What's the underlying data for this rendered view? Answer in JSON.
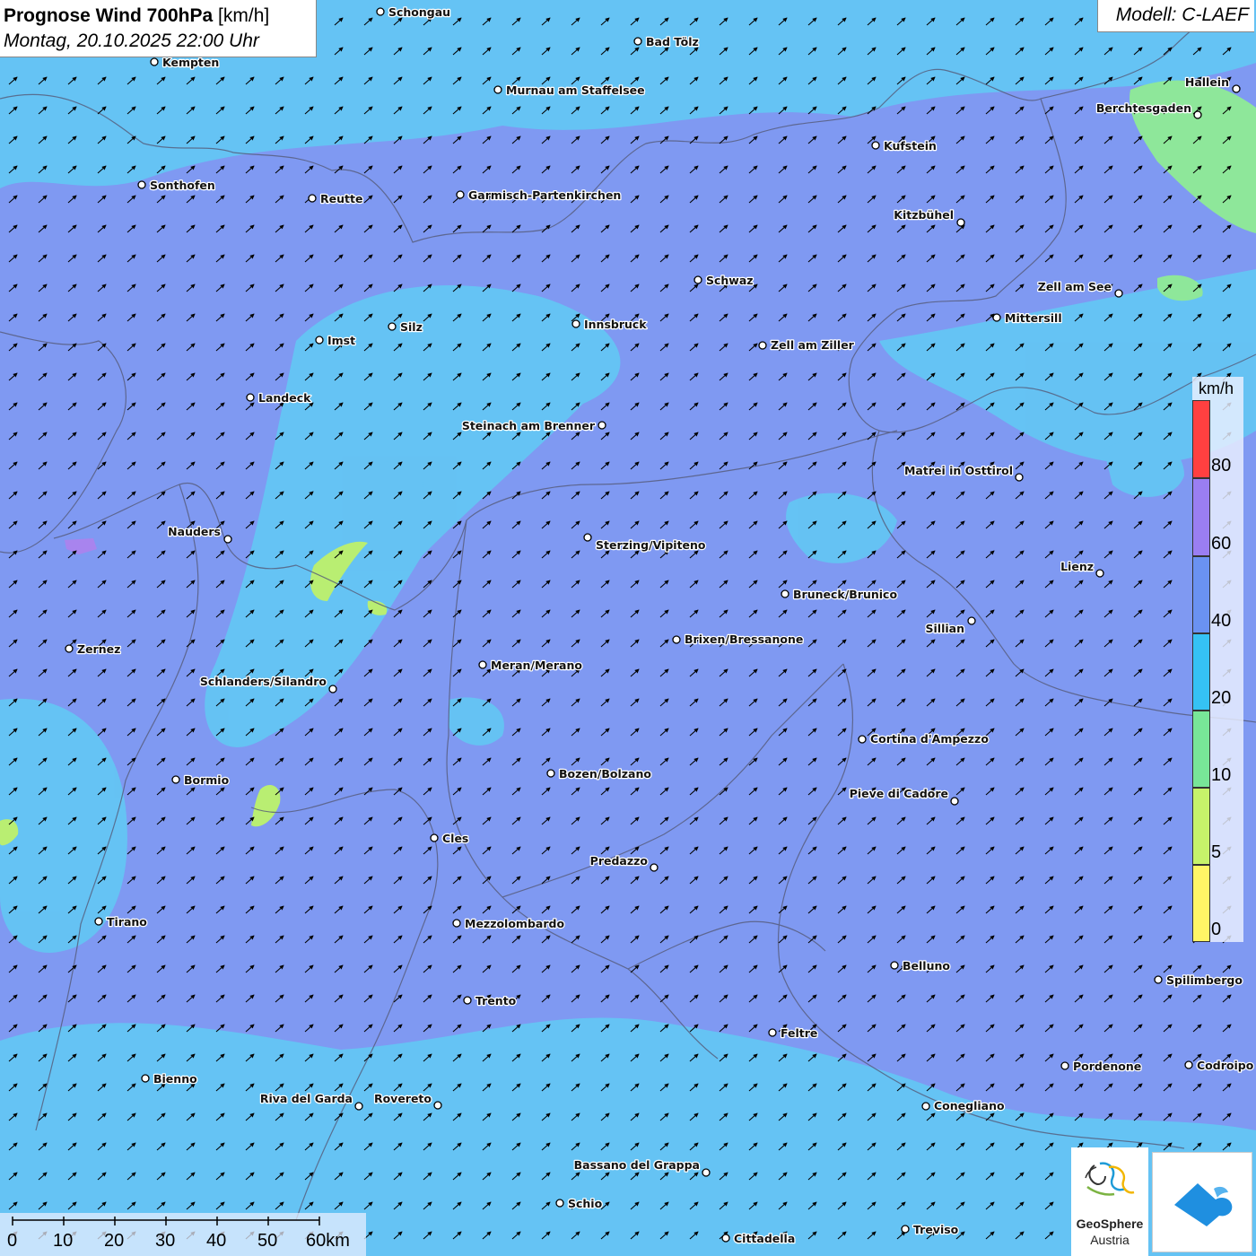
{
  "title": {
    "main": "Prognose Wind 700hPa",
    "unit": " [km/h]",
    "datetime": "Montag, 20.10.2025 22:00 Uhr"
  },
  "model": "Modell: C-LAEF",
  "legend": {
    "unit": "km/h",
    "labels": [
      "80",
      "60",
      "40",
      "20",
      "10",
      "5",
      "0"
    ],
    "bins": [
      {
        "from": 80,
        "color": "#ff4040"
      },
      {
        "from": 60,
        "color": "#9a7ef2"
      },
      {
        "from": 40,
        "color": "#6a92f2"
      },
      {
        "from": 20,
        "color": "#35c2f4"
      },
      {
        "from": 10,
        "color": "#78e698"
      },
      {
        "from": 5,
        "color": "#c6f26a"
      },
      {
        "from": 0,
        "color": "#fff566"
      }
    ]
  },
  "scale": {
    "labels": [
      "0",
      "10",
      "20",
      "30",
      "40",
      "50",
      "60km"
    ]
  },
  "branding": {
    "logo_line1": "GeoSphere",
    "logo_line2": "Austria"
  },
  "wind": {
    "direction": "southwest",
    "typical_speed_range_kmh": "20-40"
  },
  "cities": [
    "Schongau",
    "Bad Tölz",
    "Kempten",
    "Murnau am Staffelsee",
    "Hallein",
    "Berchtesgaden",
    "Kufstein",
    "Sonthofen",
    "Reutte",
    "Garmisch-Partenkirchen",
    "Kitzbühel",
    "Schwaz",
    "Zell am See",
    "Mittersill",
    "Innsbruck",
    "Silz",
    "Imst",
    "Zell am Ziller",
    "Landeck",
    "Steinach am Brenner",
    "Matrei in Osttirol",
    "Nauders",
    "Sterzing/Vipiteno",
    "Lienz",
    "Bruneck/Brunico",
    "Sillian",
    "Brixen/Bressanone",
    "Zernez",
    "Meran/Merano",
    "Schlanders/Silandro",
    "Cortina d'Ampezzo",
    "Bozen/Bolzano",
    "Bormio",
    "Pieve di Cadore",
    "Cles",
    "Predazzo",
    "Tirano",
    "Mezzolombardo",
    "Belluno",
    "Spilimbergo",
    "Trento",
    "Feltre",
    "Pordenone",
    "Codroipo",
    "Bienno",
    "Riva del Garda",
    "Rovereto",
    "Conegliano",
    "Bassano del Grappa",
    "Schio",
    "Treviso",
    "Cittadella"
  ]
}
